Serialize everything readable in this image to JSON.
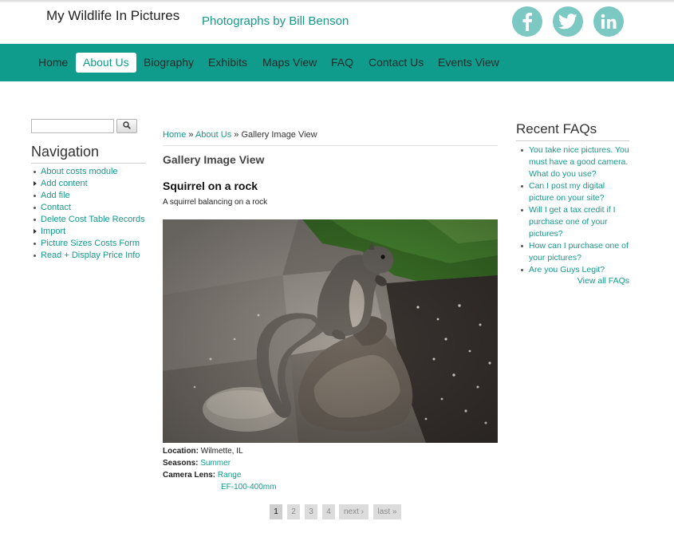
{
  "header": {
    "site_name": "My Wildlife In Pictures",
    "slogan": "Photographs by Bill Benson",
    "social": [
      {
        "icon": "facebook-icon",
        "color": "#7cc8c3"
      },
      {
        "icon": "twitter-icon",
        "color": "#7cc8c3"
      },
      {
        "icon": "linkedin-icon",
        "color": "#7cc8c3"
      }
    ]
  },
  "main_nav": {
    "items": [
      "Home",
      "About Us",
      "Biography",
      "Exhibits",
      "Maps View",
      "FAQ",
      "Contact Us",
      "Events View"
    ],
    "active": "About Us",
    "bar_color": "#0f9c8c"
  },
  "sidebar": {
    "search_value": "",
    "navigation_title": "Navigation",
    "items": [
      {
        "label": "About costs module",
        "marker": "bullet"
      },
      {
        "label": "Add content",
        "marker": "arrow"
      },
      {
        "label": "Add file",
        "marker": "bullet"
      },
      {
        "label": "Contact",
        "marker": "bullet"
      },
      {
        "label": "Delete Cost Table Records",
        "marker": "bullet"
      },
      {
        "label": "Import",
        "marker": "arrow"
      },
      {
        "label": "Picture Sizes Costs Form",
        "marker": "bullet"
      },
      {
        "label": "Read + Display Price Info",
        "marker": "bullet"
      }
    ]
  },
  "breadcrumb": {
    "home": "Home",
    "sep1": " » ",
    "about": "About Us",
    "sep2": " » ",
    "current": "Gallery Image View"
  },
  "main": {
    "page_title": "Gallery Image View",
    "node_title": "Squirrel on a rock",
    "description": "A squirrel balancing on a rock",
    "fields": {
      "location_label": "Location:",
      "location_value": "Wilmette, IL",
      "seasons_label": "Seasons:",
      "seasons_value": "Summer",
      "lens_label": "Camera Lens:",
      "lens_value_1": "Range",
      "lens_value_2": "EF-100-400mm"
    }
  },
  "pager": {
    "items": [
      "1",
      "2",
      "3",
      "4",
      "next ›",
      "last »"
    ],
    "current": "1"
  },
  "faqs": {
    "title": "Recent FAQs",
    "items": [
      "You take nice pictures. You must have a good camera. What do you use?",
      "Can I post my digital picture on your site?",
      "Will I get a tax credit if I purchase one of your pictures?",
      "How can I purchase one of your pictures?",
      "Are you Guys Legit?"
    ],
    "view_all": "View all FAQs"
  }
}
